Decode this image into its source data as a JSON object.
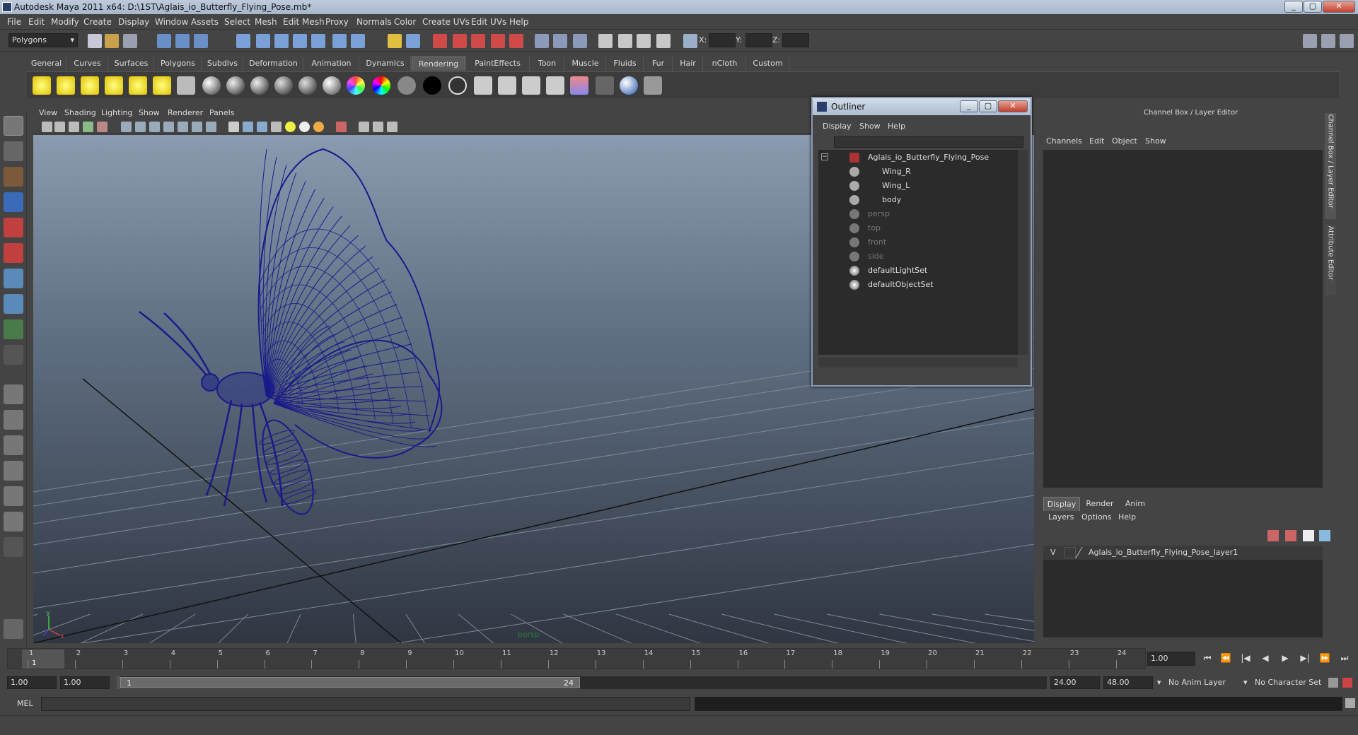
{
  "window": {
    "title": "Autodesk Maya 2011 x64: D:\\1ST\\Aglais_io_Butterfly_Flying_Pose.mb*",
    "min": "_",
    "max": "▢",
    "close": "✕"
  },
  "menu": [
    "File",
    "Edit",
    "Modify",
    "Create",
    "Display",
    "Window",
    "Assets",
    "Select",
    "Mesh",
    "Edit Mesh",
    "Proxy",
    "Normals",
    "Color",
    "Create UVs",
    "Edit UVs",
    "Help"
  ],
  "status": {
    "mode": "Polygons",
    "x_label": "X:",
    "y_label": "Y:",
    "z_label": "Z:"
  },
  "shelf_tabs": [
    "General",
    "Curves",
    "Surfaces",
    "Polygons",
    "Subdivs",
    "Deformation",
    "Animation",
    "Dynamics",
    "Rendering",
    "PaintEffects",
    "Toon",
    "Muscle",
    "Fluids",
    "Fur",
    "Hair",
    "nCloth",
    "Custom"
  ],
  "shelf_active": "Rendering",
  "viewport": {
    "menu": [
      "View",
      "Shading",
      "Lighting",
      "Show",
      "Renderer",
      "Panels"
    ],
    "camera": "persp",
    "wire_color": "#1a1a8a"
  },
  "outliner": {
    "title": "Outliner",
    "menu": [
      "Display",
      "Show",
      "Help"
    ],
    "collapse": "−",
    "items": [
      {
        "label": "Aglais_io_Butterfly_Flying_Pose",
        "depth": 0,
        "dim": false
      },
      {
        "label": "Wing_R",
        "depth": 1,
        "dim": false
      },
      {
        "label": "Wing_L",
        "depth": 1,
        "dim": false
      },
      {
        "label": "body",
        "depth": 1,
        "dim": false
      },
      {
        "label": "persp",
        "depth": 0,
        "dim": true
      },
      {
        "label": "top",
        "depth": 0,
        "dim": true
      },
      {
        "label": "front",
        "depth": 0,
        "dim": true
      },
      {
        "label": "side",
        "depth": 0,
        "dim": true
      },
      {
        "label": "defaultLightSet",
        "depth": 0,
        "dim": false
      },
      {
        "label": "defaultObjectSet",
        "depth": 0,
        "dim": false
      }
    ]
  },
  "channel_box": {
    "title": "Channel Box / Layer Editor",
    "menu": [
      "Channels",
      "Edit",
      "Object",
      "Show"
    ],
    "layer_tabs": [
      "Display",
      "Render",
      "Anim"
    ],
    "layer_active": "Display",
    "layer_menu": [
      "Layers",
      "Options",
      "Help"
    ],
    "layer_visibility": "V",
    "layer_name": "Aglais_io_Butterfly_Flying_Pose_layer1",
    "side_tab_1": "Channel Box / Layer Editor",
    "side_tab_2": "Attribute Editor"
  },
  "time": {
    "ticks": [
      "1",
      "2",
      "3",
      "4",
      "5",
      "6",
      "7",
      "8",
      "9",
      "10",
      "11",
      "12",
      "13",
      "14",
      "15",
      "16",
      "17",
      "18",
      "19",
      "20",
      "21",
      "22",
      "23",
      "24"
    ],
    "current": "1",
    "current_field": "1.00",
    "playback": [
      "⏮",
      "⏪",
      "|◀",
      "◀",
      "▶",
      "▶|",
      "⏩",
      "⏭"
    ]
  },
  "range": {
    "start": "1.00",
    "playback_start": "1.00",
    "thumb_start": "1",
    "thumb_end": "24",
    "playback_end": "24.00",
    "end": "48.00",
    "anim_layer": "No Anim Layer",
    "char_set": "No Character Set"
  },
  "command": {
    "label": "MEL"
  }
}
